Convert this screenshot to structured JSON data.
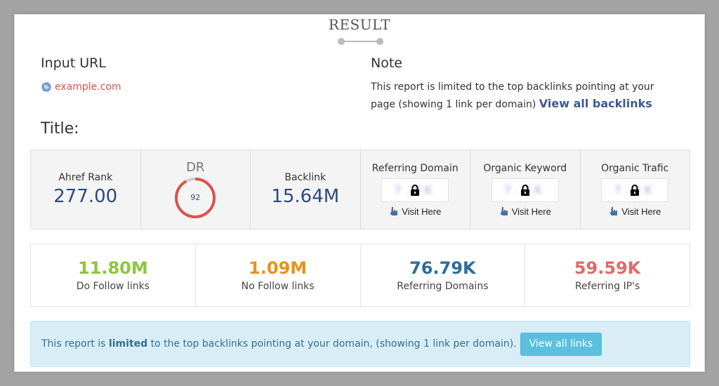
{
  "result": {
    "title": "RESULT"
  },
  "input": {
    "heading": "Input URL",
    "url": "example.com"
  },
  "note": {
    "heading": "Note",
    "text": "This report is limited to the top backlinks pointing at your page (showing 1 link per domain)",
    "link": "View all backlinks"
  },
  "page": {
    "title": "Title:"
  },
  "stats": {
    "ahref_rank": {
      "label": "Ahref Rank",
      "value": "277.00"
    },
    "dr": {
      "label": "DR",
      "value": "92",
      "percent": 92
    },
    "backlink": {
      "label": "Backlink",
      "value": "15.64M"
    },
    "referring_domain": {
      "label": "Referring Domain",
      "visit": "Visit Here"
    },
    "organic_keyword": {
      "label": "Organic Keyword",
      "visit": "Visit Here"
    },
    "organic_traffic": {
      "label": "Organic Trafic",
      "visit": "Visit Here"
    }
  },
  "links": [
    {
      "value": "11.80M",
      "label": "Do Follow links",
      "color": "#8dc63f"
    },
    {
      "value": "1.09M",
      "label": "No Follow links",
      "color": "#e8921b"
    },
    {
      "value": "76.79K",
      "label": "Referring Domains",
      "color": "#2c6e9c"
    },
    {
      "value": "59.59K",
      "label": "Referring IP's",
      "color": "#e06a6a"
    }
  ],
  "info": {
    "text_before": "This report is",
    "text_bold": "limited",
    "text_after": "to the top backlinks pointing at your domain, (showing 1 link per domain).",
    "button": "View all links"
  },
  "colors": {
    "accent_red": "#d9534f",
    "navy": "#2c4a80",
    "info_bg": "#d9edf7",
    "info_button": "#5bc0de"
  }
}
